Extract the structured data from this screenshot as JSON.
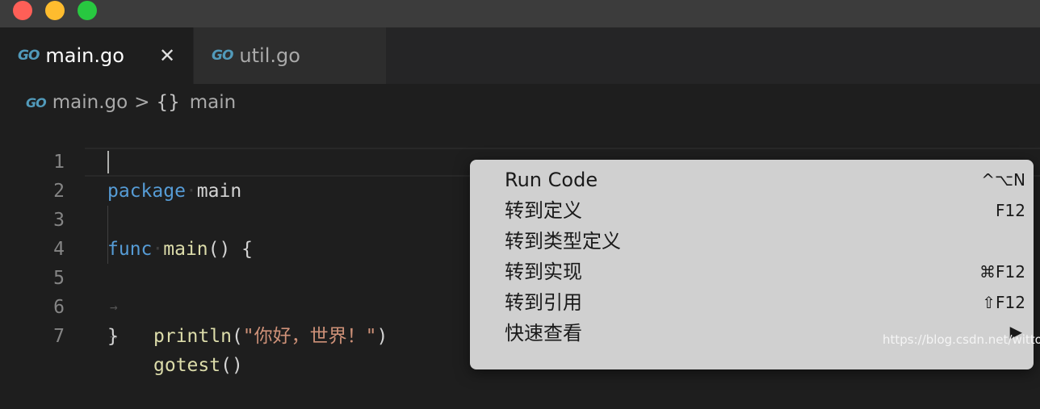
{
  "window": {
    "buttons": [
      "close",
      "minimize",
      "maximize"
    ]
  },
  "tabs": [
    {
      "icon": "go-icon",
      "icon_text": "GO",
      "label": "main.go",
      "active": true
    },
    {
      "icon": "go-icon",
      "icon_text": "GO",
      "label": "util.go",
      "active": false
    }
  ],
  "tab_close_glyph": "✕",
  "breadcrumb": {
    "icon_text": "GO",
    "file": "main.go",
    "separator": ">",
    "symbol_icon": "{}",
    "symbol": "main"
  },
  "editor": {
    "line_numbers": [
      "1",
      "2",
      "3",
      "4",
      "5",
      "6",
      "7"
    ],
    "lines": {
      "l1_kw": "package",
      "l1_name": "main",
      "l3_kw": "func",
      "l3_fn": "main",
      "l3_rest": "() {",
      "l4_fn": "println",
      "l4_open": "(",
      "l4_str": "\"你好，世界！\"",
      "l4_close": ")",
      "l5_fn": "gotest",
      "l5_rest": "()",
      "l6": "}"
    },
    "tab_arrow": "→"
  },
  "context_menu": {
    "items": [
      {
        "label": "Run Code",
        "shortcut": "^⌥N"
      },
      {
        "label": "转到定义",
        "shortcut": "F12"
      },
      {
        "label": "转到类型定义",
        "shortcut": ""
      },
      {
        "label": "转到实现",
        "shortcut": "⌘F12"
      },
      {
        "label": "转到引用",
        "shortcut": "⇧F12"
      },
      {
        "label": "快速查看",
        "shortcut": "▶"
      }
    ]
  },
  "watermark": "https://blog.csdn.net/witton",
  "colors": {
    "editor_bg": "#1e1e1e",
    "keyword": "#569cd6",
    "function": "#dcdcaa",
    "string": "#ce9178",
    "menu_bg": "#d0d0d0"
  }
}
